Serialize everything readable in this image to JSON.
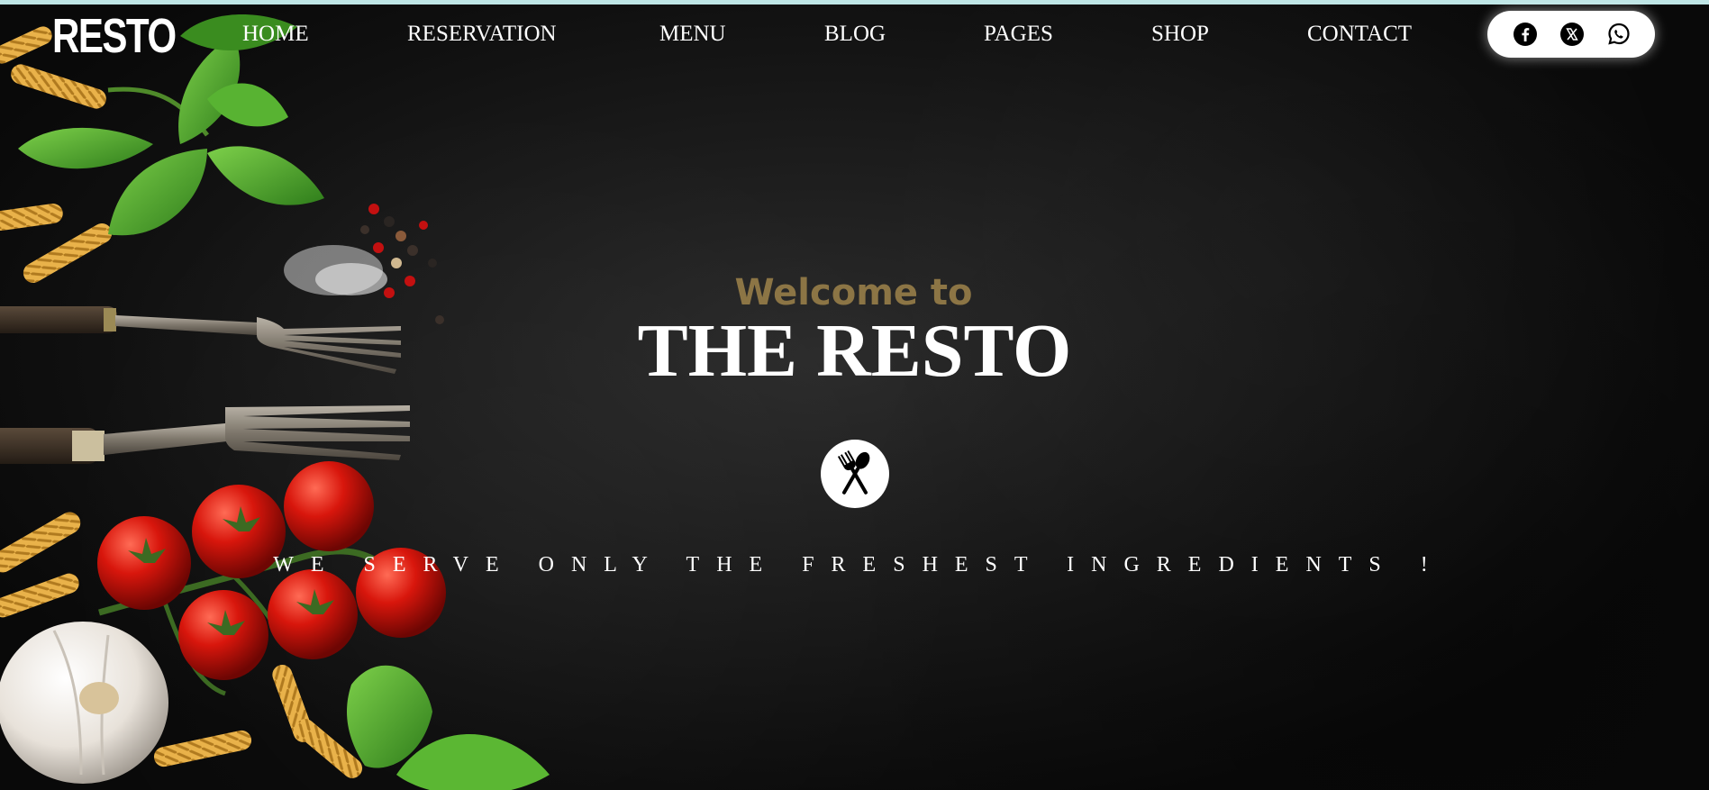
{
  "brand": {
    "logo_text": "RESTO"
  },
  "nav": {
    "items": [
      {
        "label": "HOME"
      },
      {
        "label": "RESERVATION"
      },
      {
        "label": "MENU"
      },
      {
        "label": "BLOG"
      },
      {
        "label": "PAGES"
      },
      {
        "label": "SHOP"
      },
      {
        "label": "CONTACT"
      }
    ]
  },
  "social": {
    "icons": [
      "facebook-icon",
      "x-twitter-icon",
      "whatsapp-icon"
    ]
  },
  "hero": {
    "welcome": "Welcome to",
    "title": "THE RESTO",
    "emblem_icon": "fork-spoon-icon",
    "tagline": "WE SERVE ONLY THE FRESHEST INGREDIENTS !"
  },
  "colors": {
    "background": "#121212",
    "accent_gold": "#8c7545",
    "text": "#ffffff",
    "top_bar": "#bfe6e6"
  }
}
